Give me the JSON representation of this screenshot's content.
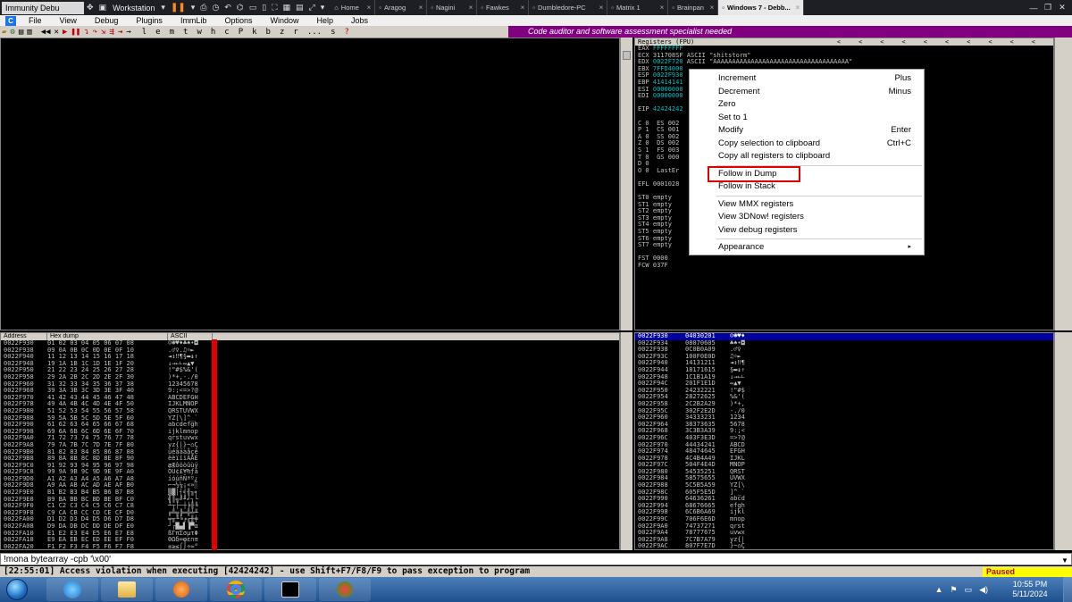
{
  "vm_bar": {
    "app_title": "Immunity Debu",
    "vm_menu": "Workstation",
    "tabs": [
      {
        "label": "Home"
      },
      {
        "label": "Aragog"
      },
      {
        "label": "Nagini"
      },
      {
        "label": "Fawkes"
      },
      {
        "label": "Dumbledore-PC"
      },
      {
        "label": "Matrix 1"
      },
      {
        "label": "Brainpan"
      },
      {
        "label": "Windows 7 - Debb..."
      }
    ]
  },
  "menu": {
    "items": [
      "File",
      "View",
      "Debug",
      "Plugins",
      "ImmLib",
      "Options",
      "Window",
      "Help",
      "Jobs"
    ]
  },
  "toolbar": {
    "letters": [
      "l",
      "e",
      "m",
      "t",
      "w",
      "h",
      "c",
      "P",
      "k",
      "b",
      "z",
      "r",
      "...",
      "s",
      "?"
    ],
    "banner": "Code auditor and software assessment specialist needed"
  },
  "registers": {
    "title": "Registers (FPU)",
    "lines": [
      "EAX FFFFFFFF",
      "ECX 311708SF ASCII \"shitstorm\"",
      "EDX 0022F720 ASCII \"AAAAAAAAAAAAAAAAAAAAAAAAAAAAAAAAAAAA\"",
      "EBX 7FFD4000",
      "ESP 0022F930",
      "EBP 41414141",
      "ESI 00000000",
      "EDI 00000000",
      "",
      "EIP 42424242",
      "",
      "C 0  ES 002",
      "P 1  CS 001",
      "A 0  SS 002",
      "Z 0  DS 002",
      "S 1  FS 003",
      "T 0  GS 000",
      "D 0",
      "O 0  LastEr",
      "",
      "EFL 0001028",
      "",
      "ST0 empty",
      "ST1 empty",
      "ST2 empty",
      "ST3 empty",
      "ST4 empty",
      "ST5 empty",
      "ST6 empty",
      "ST7 empty",
      "",
      "FST 0000",
      "FCW 037F"
    ]
  },
  "context_menu": {
    "items": [
      {
        "label": "Increment",
        "shortcut": "Plus"
      },
      {
        "label": "Decrement",
        "shortcut": "Minus"
      },
      {
        "label": "Zero",
        "shortcut": ""
      },
      {
        "label": "Set to 1",
        "shortcut": ""
      },
      {
        "label": "Modify",
        "shortcut": "Enter"
      },
      {
        "label": "Copy selection to clipboard",
        "shortcut": "Ctrl+C"
      },
      {
        "label": "Copy all registers to clipboard",
        "shortcut": ""
      },
      {
        "label": "Follow in Dump",
        "shortcut": "",
        "highlighted": true
      },
      {
        "label": "Follow in Stack",
        "shortcut": ""
      },
      {
        "label": "View MMX registers",
        "shortcut": ""
      },
      {
        "label": "View 3DNow! registers",
        "shortcut": ""
      },
      {
        "label": "View debug registers",
        "shortcut": ""
      },
      {
        "label": "Appearance",
        "shortcut": "▸"
      }
    ]
  },
  "dump": {
    "headers": [
      "Address",
      "Hex dump",
      "ASCII"
    ],
    "rows": [
      [
        "0022F930",
        "01 02 03 04 05 06 07 08",
        "☺☻♥♦♣♠•◘"
      ],
      [
        "0022F938",
        "09 0A 0B 0C 0D 0E 0F 10",
        ".♂♀.♫☼►"
      ],
      [
        "0022F940",
        "11 12 13 14 15 16 17 18",
        "◄↕‼¶§▬↨↑"
      ],
      [
        "0022F948",
        "19 1A 1B 1C 1D 1E 1F 20",
        "↓→←∟↔▲▼ "
      ],
      [
        "0022F950",
        "21 22 23 24 25 26 27 28",
        "!\"#$%&'("
      ],
      [
        "0022F958",
        "29 2A 2B 2C 2D 2E 2F 30",
        ")*+,-./0"
      ],
      [
        "0022F960",
        "31 32 33 34 35 36 37 38",
        "12345678"
      ],
      [
        "0022F968",
        "39 3A 3B 3C 3D 3E 3F 40",
        "9:;<=>?@"
      ],
      [
        "0022F970",
        "41 42 43 44 45 46 47 48",
        "ABCDEFGH"
      ],
      [
        "0022F978",
        "49 4A 4B 4C 4D 4E 4F 50",
        "IJKLMNOP"
      ],
      [
        "0022F980",
        "51 52 53 54 55 56 57 58",
        "QRSTUVWX"
      ],
      [
        "0022F988",
        "59 5A 5B 5C 5D 5E 5F 60",
        "YZ[\\]^_`"
      ],
      [
        "0022F990",
        "61 62 63 64 65 66 67 68",
        "abcdefgh"
      ],
      [
        "0022F998",
        "69 6A 6B 6C 6D 6E 6F 70",
        "ijklmnop"
      ],
      [
        "0022F9A0",
        "71 72 73 74 75 76 77 78",
        "qrstuvwx"
      ],
      [
        "0022F9A8",
        "79 7A 7B 7C 7D 7E 7F 80",
        "yz{|}~⌂Ç"
      ],
      [
        "0022F9B0",
        "81 82 83 84 85 86 87 88",
        "üéâäàåçê"
      ],
      [
        "0022F9B8",
        "89 8A 8B 8C 8D 8E 8F 90",
        "ëèïîìÄÅÉ"
      ],
      [
        "0022F9C0",
        "91 92 93 94 95 96 97 98",
        "æÆôöòûùÿ"
      ],
      [
        "0022F9C8",
        "99 9A 9B 9C 9D 9E 9F A0",
        "ÖÜ¢£¥₧ƒá"
      ],
      [
        "0022F9D0",
        "A1 A2 A3 A4 A5 A6 A7 A8",
        "íóúñÑªº¿"
      ],
      [
        "0022F9D8",
        "A9 AA AB AC AD AE AF B0",
        "⌐¬½¼¡«»░"
      ],
      [
        "0022F9E0",
        "B1 B2 B3 B4 B5 B6 B7 B8",
        "▒▓│┤╡╢╖╕"
      ],
      [
        "0022F9E8",
        "B9 BA BB BC BD BE BF C0",
        "╣║╗╝╜╛┐└"
      ],
      [
        "0022F9F0",
        "C1 C2 C3 C4 C5 C6 C7 C8",
        "┴┬├─┼╞╟╚"
      ],
      [
        "0022F9F8",
        "C9 CA CB CC CD CE CF D0",
        "╔╩╦╠═╬╧╨"
      ],
      [
        "0022FA00",
        "D1 D2 D3 D4 D5 D6 D7 D8",
        "╤╥╙╘╒╓╫╪"
      ],
      [
        "0022FA08",
        "D9 DA DB DC DD DE DF E0",
        "┘┌█▄▌▐▀α"
      ],
      [
        "0022FA10",
        "E1 E2 E3 E4 E5 E6 E7 E8",
        "ßΓπΣσµτΦ"
      ],
      [
        "0022FA18",
        "E9 EA EB EC ED EE EF F0",
        "ΘΩδ∞φε∩≡"
      ],
      [
        "0022FA20",
        "F1 F2 F3 F4 F5 F6 F7 F8",
        "±≥≤⌠⌡÷≈°"
      ],
      [
        "0022FA28",
        "F9 FA FB FC FD FE FF 00",
        "∙·√ⁿ²■ ."
      ],
      [
        "0022FA30",
        "ED F8 55 16 5E AD 6E 76",
        "φ°U▬^¡nv"
      ],
      [
        "0022FA38",
        "FE FF FF FF 36 F6 59 77",
        "■   6÷Yw"
      ],
      [
        "0022FA40",
        "D3 F3 56 77 00 00 00 00",
        "╙≤Vw...."
      ],
      [
        "0022FA48",
        "00 00 CA 75 00 00 00 00",
        "..╩u...."
      ],
      [
        "0022FA50",
        "00 00 1B 36 00 01 00 00",
        "..←6.☺.."
      ],
      [
        "0022FA58",
        "00 00 00 00 00 00 00 00",
        "........"
      ]
    ]
  },
  "stack": {
    "rows": [
      [
        "0022F930",
        "04030201",
        "☺☻♥♦"
      ],
      [
        "0022F934",
        "08070605",
        "♣♠•◘"
      ],
      [
        "0022F938",
        "0C0B0A09",
        ".♂♀"
      ],
      [
        "0022F93C",
        "100F0E0D",
        "♫☼►"
      ],
      [
        "0022F940",
        "14131211",
        "◄↕‼¶"
      ],
      [
        "0022F944",
        "18171615",
        "§▬↨↑"
      ],
      [
        "0022F948",
        "1C1B1A19",
        "↓→←∟"
      ],
      [
        "0022F94C",
        "201F1E1D",
        "↔▲▼ "
      ],
      [
        "0022F950",
        "24232221",
        "!\"#$"
      ],
      [
        "0022F954",
        "28272625",
        "%&'("
      ],
      [
        "0022F958",
        "2C2B2A29",
        ")*+,"
      ],
      [
        "0022F95C",
        "302F2E2D",
        "-./0"
      ],
      [
        "0022F960",
        "34333231",
        "1234"
      ],
      [
        "0022F964",
        "38373635",
        "5678"
      ],
      [
        "0022F968",
        "3C3B3A39",
        "9:;<"
      ],
      [
        "0022F96C",
        "403F3E3D",
        "=>?@"
      ],
      [
        "0022F970",
        "44434241",
        "ABCD"
      ],
      [
        "0022F974",
        "48474645",
        "EFGH"
      ],
      [
        "0022F978",
        "4C4B4A49",
        "IJKL"
      ],
      [
        "0022F97C",
        "504F4E4D",
        "MNOP"
      ],
      [
        "0022F980",
        "54535251",
        "QRST"
      ],
      [
        "0022F984",
        "58575655",
        "UVWX"
      ],
      [
        "0022F988",
        "5C5B5A59",
        "YZ[\\"
      ],
      [
        "0022F98C",
        "605F5E5D",
        "]^_`"
      ],
      [
        "0022F990",
        "64636261",
        "abcd"
      ],
      [
        "0022F994",
        "68676665",
        "efgh"
      ],
      [
        "0022F998",
        "6C6B6A69",
        "ijkl"
      ],
      [
        "0022F99C",
        "706F6E6D",
        "mnop"
      ],
      [
        "0022F9A0",
        "74737271",
        "qrst"
      ],
      [
        "0022F9A4",
        "78777675",
        "uvwx"
      ],
      [
        "0022F9A8",
        "7C7B7A79",
        "yz{|"
      ],
      [
        "0022F9AC",
        "807F7E7D",
        "}~⌂Ç"
      ],
      [
        "0022F9B0",
        "84838281",
        "üéâä"
      ],
      [
        "0022F9B4",
        "88878685",
        "àåçê"
      ],
      [
        "0022F9B8",
        "8C8B8A89",
        "ëèïî"
      ],
      [
        "0022F9BC",
        "908F8E8D",
        "ìÄÅÉ"
      ],
      [
        "0022F9C0",
        "94939291",
        "æÆôö"
      ],
      [
        "0022F9C4",
        "98979695",
        "òûùÿ"
      ],
      [
        "0022F9C8",
        "9C9B9A99",
        "ÖÜ¢£"
      ],
      [
        "0022F9CC",
        "A09F9E9D",
        "¥₧ƒá"
      ],
      [
        "0022F9D0",
        "A4A3A2A1",
        "íóúñ"
      ]
    ]
  },
  "command": {
    "value": "!mona bytearray -cpb '\\x00'"
  },
  "status": {
    "message": "[22:55:01] Access violation when executing [42424242] - use Shift+F7/F8/F9 to pass exception to program",
    "state": "Paused"
  },
  "taskbar": {
    "time": "10:55 PM",
    "date": "5/11/2024"
  }
}
